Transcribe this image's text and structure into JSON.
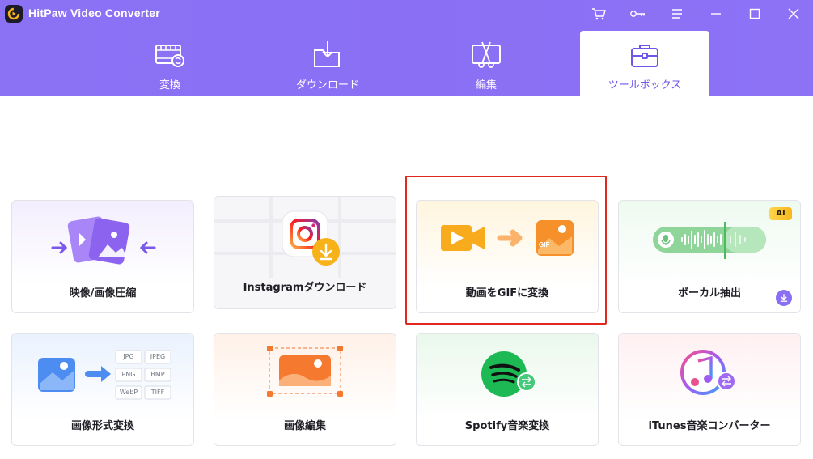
{
  "app": {
    "title": "HitPaw Video Converter"
  },
  "titlebar": {
    "icons": [
      "cart-icon",
      "key-icon",
      "menu-icon",
      "minimize-icon",
      "maximize-icon",
      "close-icon"
    ]
  },
  "nav": {
    "tabs": [
      {
        "label": "変換",
        "icon": "convert-film-icon"
      },
      {
        "label": "ダウンロード",
        "icon": "download-folder-icon"
      },
      {
        "label": "編集",
        "icon": "edit-scissors-icon"
      },
      {
        "label": "ツールボックス",
        "icon": "toolbox-icon",
        "active": true
      }
    ]
  },
  "tools": [
    {
      "label": "映像/画像圧縮",
      "icon": "compress-icon"
    },
    {
      "label": "Instagramダウンロード",
      "icon": "instagram-icon"
    },
    {
      "label": "動画をGIFに変換",
      "icon": "video-to-gif-icon",
      "highlighted": true
    },
    {
      "label": "ボーカル抽出",
      "icon": "vocal-waveform-icon",
      "badge": "AI"
    },
    {
      "label": "画像形式変換",
      "icon": "image-format-icon",
      "formats": [
        "JPG",
        "JPEG",
        "PNG",
        "BMP",
        "WebP",
        "TIFF"
      ]
    },
    {
      "label": "画像編集",
      "icon": "image-edit-icon"
    },
    {
      "label": "Spotify音楽変換",
      "icon": "spotify-icon"
    },
    {
      "label": "iTunes音楽コンバーター",
      "icon": "itunes-icon"
    }
  ],
  "illustrations": {
    "gif_tag": "GIF"
  },
  "colors": {
    "header": "#8a6ff4",
    "accent": "#6d57e8",
    "highlight": "#e0281e",
    "spotify": "#1db954"
  }
}
